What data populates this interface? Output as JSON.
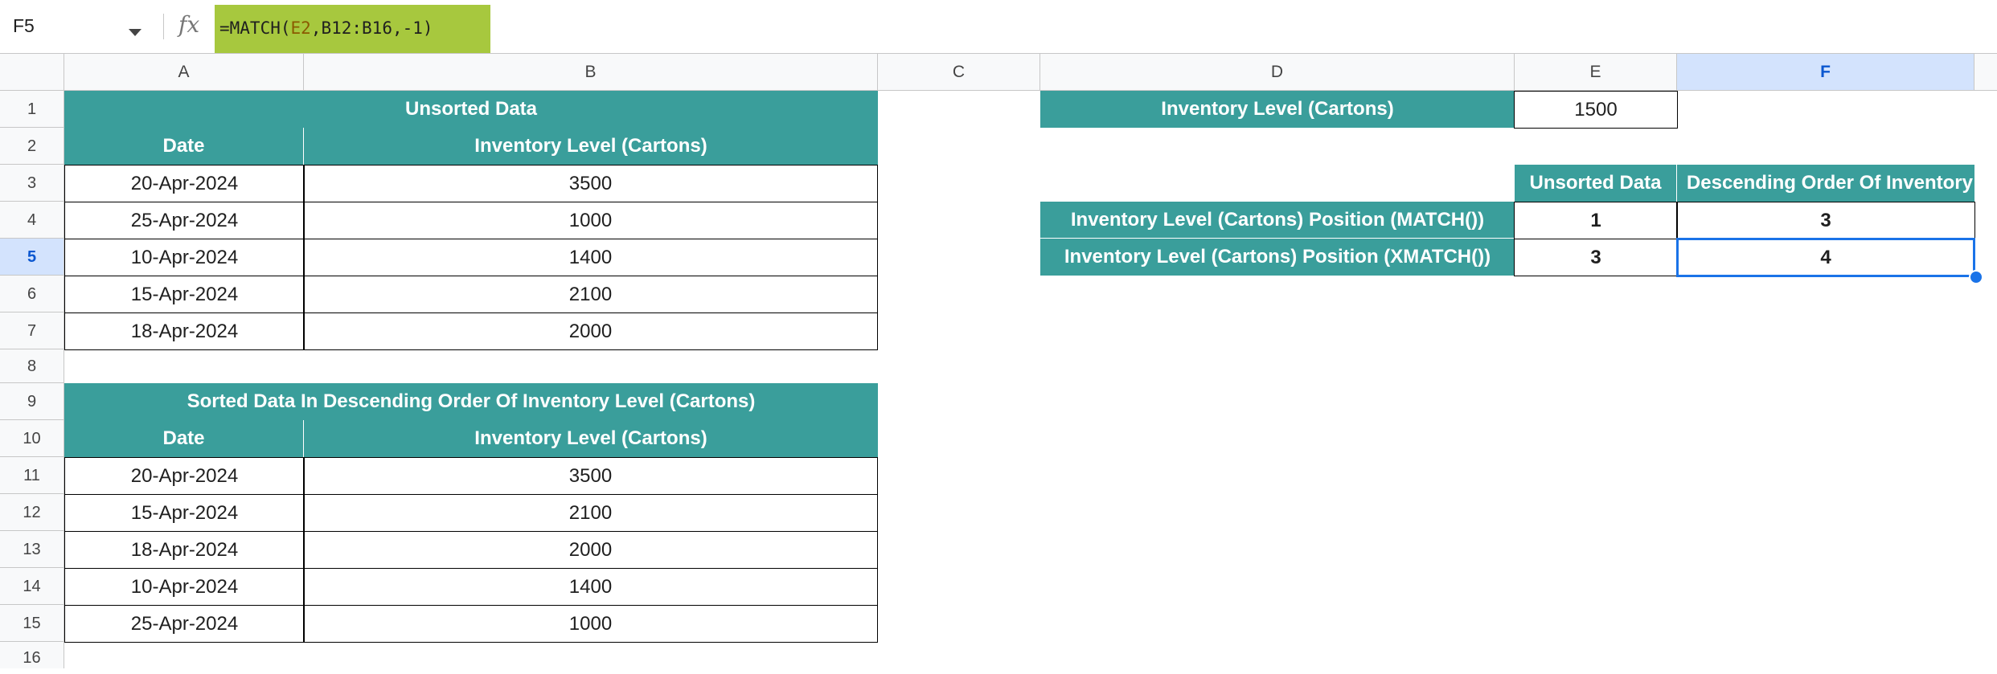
{
  "formula_bar": {
    "name_box": "F5",
    "fx_label": "fx",
    "formula_prefix": "=MATCH(",
    "formula_ref": "E2",
    "formula_suffix": ",B12:B16,-1)"
  },
  "columns": [
    "A",
    "B",
    "C",
    "D",
    "E",
    "F"
  ],
  "rows": [
    "1",
    "2",
    "3",
    "4",
    "5",
    "6",
    "7",
    "8",
    "9",
    "10",
    "11",
    "12",
    "13",
    "14",
    "15",
    "16"
  ],
  "unsorted": {
    "title": "Unsorted Data",
    "headers": [
      "Date",
      "Inventory Level (Cartons)"
    ],
    "rows": [
      [
        "20-Apr-2024",
        "3500"
      ],
      [
        "25-Apr-2024",
        "1000"
      ],
      [
        "10-Apr-2024",
        "1400"
      ],
      [
        "15-Apr-2024",
        "2100"
      ],
      [
        "18-Apr-2024",
        "2000"
      ]
    ]
  },
  "sorted": {
    "title": "Sorted Data In Descending Order Of Inventory Level (Cartons)",
    "headers": [
      "Date",
      "Inventory Level (Cartons)"
    ],
    "rows": [
      [
        "20-Apr-2024",
        "3500"
      ],
      [
        "15-Apr-2024",
        "2100"
      ],
      [
        "18-Apr-2024",
        "2000"
      ],
      [
        "10-Apr-2024",
        "1400"
      ],
      [
        "25-Apr-2024",
        "1000"
      ]
    ]
  },
  "lookup": {
    "label": "Inventory Level (Cartons)",
    "value": "1500"
  },
  "results": {
    "headers": [
      "Unsorted Data",
      "Descending Order Of Inventory"
    ],
    "rows": [
      {
        "label": "Inventory Level (Cartons) Position (MATCH())",
        "unsorted": "1",
        "descending": "3"
      },
      {
        "label": "Inventory Level (Cartons) Position (XMATCH())",
        "unsorted": "3",
        "descending": "4"
      }
    ]
  },
  "colors": {
    "header_fill": "#3a9e9b",
    "formula_highlight": "#a7c83e",
    "selection": "#1a73e8"
  }
}
